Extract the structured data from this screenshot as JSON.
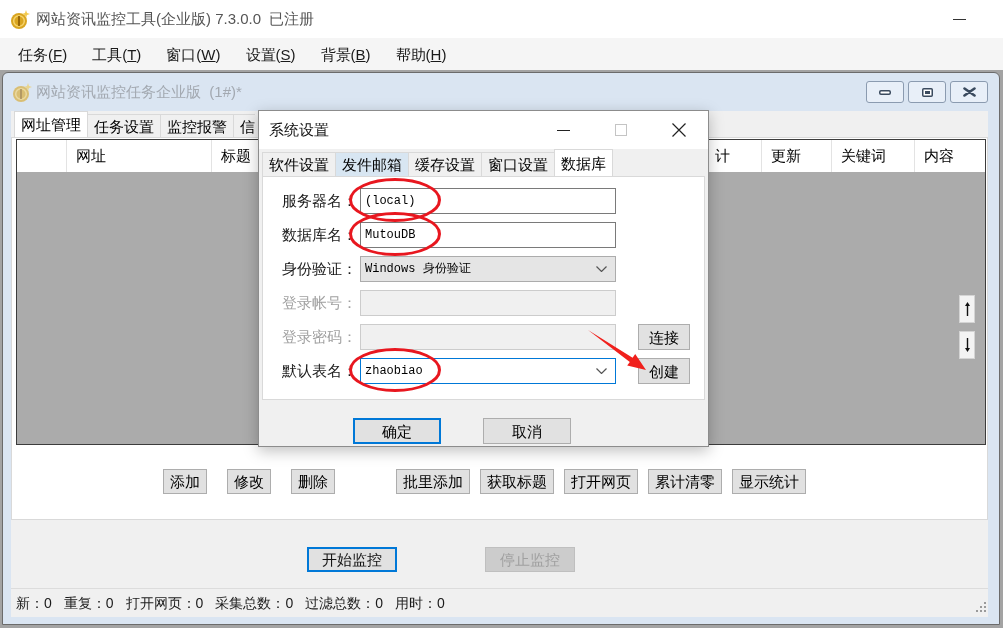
{
  "window": {
    "title": "网站资讯监控工具(企业版) 7.3.0.0  已注册"
  },
  "menu": [
    {
      "label": "任务(F)"
    },
    {
      "label": "工具(T)"
    },
    {
      "label": "窗口(W)"
    },
    {
      "label": "设置(S)"
    },
    {
      "label": "背景(B)"
    },
    {
      "label": "帮助(H)"
    }
  ],
  "child_window": {
    "title": "网站资讯监控任务企业版  (1#)*",
    "active": false,
    "tabs": [
      {
        "label": "网址管理",
        "selected": true
      },
      {
        "label": "任务设置",
        "selected": false
      },
      {
        "label": "监控报警",
        "selected": false
      },
      {
        "label": "信",
        "selected": false
      }
    ],
    "table": {
      "columns": [
        {
          "label": "网址"
        },
        {
          "label": "标题"
        },
        {
          "label": "计"
        },
        {
          "label": "更新"
        },
        {
          "label": "关键词"
        },
        {
          "label": "内容"
        }
      ]
    },
    "button_groups": [
      [
        {
          "label": "添加"
        },
        {
          "label": "修改"
        },
        {
          "label": "删除"
        }
      ],
      [
        {
          "label": "批里添加"
        },
        {
          "label": "获取标题"
        },
        {
          "label": "打开网页"
        },
        {
          "label": "累计清零"
        },
        {
          "label": "显示统计"
        }
      ]
    ],
    "monitor_buttons": [
      {
        "label": "开始监控",
        "focused": true,
        "disabled": false
      },
      {
        "label": "停止监控",
        "focused": false,
        "disabled": true
      }
    ],
    "status_bar": [
      {
        "label": "新：",
        "value": "0"
      },
      {
        "label": "重复：",
        "value": "0"
      },
      {
        "label": "打开网页：",
        "value": "0"
      },
      {
        "label": "采集总数：",
        "value": "0"
      },
      {
        "label": "过滤总数：",
        "value": "0"
      },
      {
        "label": "用时：",
        "value": "0"
      }
    ]
  },
  "dialog": {
    "title": "系统设置",
    "tabs": [
      {
        "label": "软件设置",
        "selected": false,
        "hovered": false
      },
      {
        "label": "发件邮箱",
        "selected": false,
        "hovered": true
      },
      {
        "label": "缓存设置",
        "selected": false,
        "hovered": false
      },
      {
        "label": "窗口设置",
        "selected": false,
        "hovered": false
      },
      {
        "label": "数据库",
        "selected": true,
        "hovered": false
      }
    ],
    "fields": [
      {
        "label": "服务器名：",
        "kind": "text",
        "value": "(local)",
        "disabled": false,
        "focused": false,
        "circled": true
      },
      {
        "label": "数据库名：",
        "kind": "text",
        "value": "MutouDB",
        "disabled": false,
        "focused": false,
        "circled": true
      },
      {
        "label": "身份验证：",
        "kind": "select",
        "value": "Windows 身份验证",
        "disabled": false,
        "focused": false,
        "circled": false
      },
      {
        "label": "登录帐号：",
        "kind": "text",
        "disabled": true,
        "focused": false,
        "circled": false
      },
      {
        "label": "登录密码：",
        "kind": "text",
        "disabled": true,
        "focused": false,
        "circled": false,
        "button": {
          "label": "连接",
          "pointed": false
        }
      },
      {
        "label": "默认表名：",
        "kind": "combo",
        "value": "zhaobiao",
        "disabled": false,
        "focused": true,
        "circled": true,
        "button": {
          "label": "创建",
          "pointed": true
        }
      }
    ],
    "buttons": [
      {
        "label": "确定",
        "focused": true
      },
      {
        "label": "取消",
        "focused": false
      }
    ]
  }
}
